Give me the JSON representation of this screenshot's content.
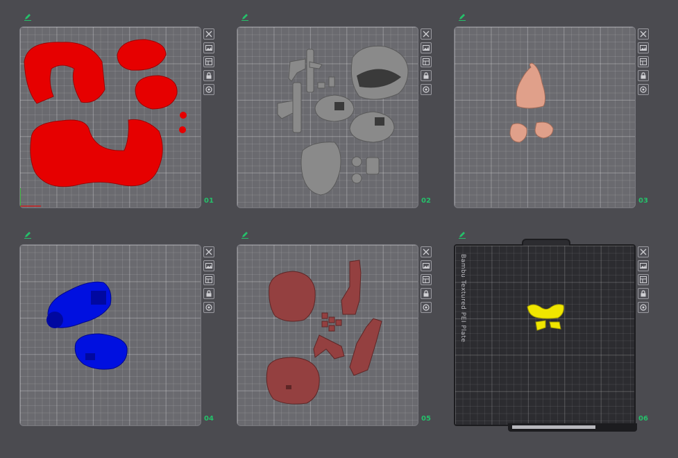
{
  "colors": {
    "background": "#4b4b50",
    "plate_number": "#25c06a",
    "plate_01_filament": "#e60000",
    "plate_02_filament": "#8a8a8a",
    "plate_03_filament": "#e0a08a",
    "plate_04_filament": "#0010e0",
    "plate_05_filament": "#944040",
    "plate_06_filament": "#f0e600"
  },
  "icons": [
    "pencil-edit-icon",
    "close-icon",
    "image-icon",
    "layout-arrange-icon",
    "lock-icon",
    "settings-gear-icon"
  ],
  "plates": [
    {
      "number": "01",
      "label": "",
      "textured": false
    },
    {
      "number": "02",
      "label": "",
      "textured": false
    },
    {
      "number": "03",
      "label": "",
      "textured": false
    },
    {
      "number": "04",
      "label": "",
      "textured": false
    },
    {
      "number": "05",
      "label": "",
      "textured": false
    },
    {
      "number": "06",
      "label": "Bambu Textured PEI Plate",
      "textured": true
    }
  ]
}
